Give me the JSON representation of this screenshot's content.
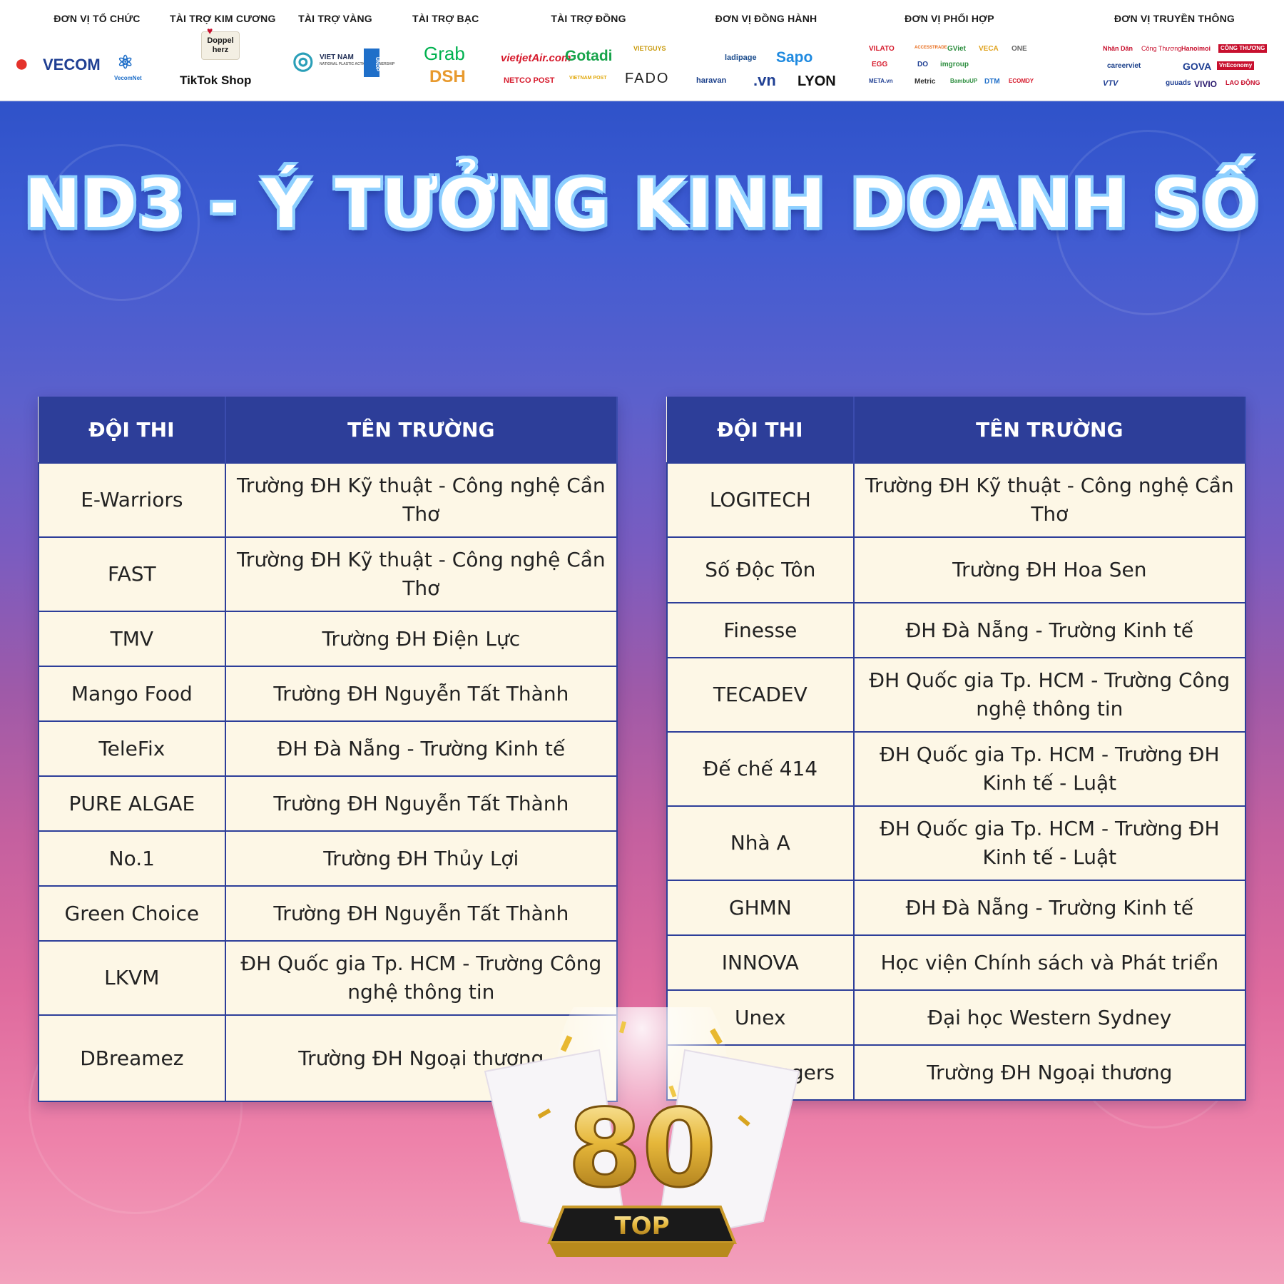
{
  "sponsors": [
    {
      "title": "ĐƠN VỊ TỔ CHỨC",
      "logos": [
        "VECOM",
        "VecomNet"
      ]
    },
    {
      "title": "TÀI TRỢ KIM CƯƠNG",
      "logos": [
        "Doppel herz",
        "TikTok Shop"
      ]
    },
    {
      "title": "TÀI TRỢ VÀNG",
      "logos": [
        "VIET NAM",
        "NATIONAL PLASTIC ACTION PARTNERSHIP",
        "UNDP"
      ]
    },
    {
      "title": "TÀI TRỢ BẠC",
      "logos": [
        "Grab",
        "DSH"
      ]
    },
    {
      "title": "TÀI TRỢ ĐỒNG",
      "logos": [
        "vietjetAir.com",
        "Gotadi",
        "VIETGUYS",
        "NETCO POST",
        "VIETNAM POST",
        "FADO"
      ]
    },
    {
      "title": "ĐƠN VỊ ĐỒNG HÀNH",
      "logos": [
        "ladipage",
        "Sapo",
        "haravan",
        ".vn",
        "LYON"
      ]
    },
    {
      "title": "ĐƠN VỊ PHỐI HỢP",
      "logos": [
        "VILATO",
        "ACCESSTRADE",
        "GViet",
        "VECA",
        "ONE",
        "EGG",
        "DO",
        "imgroup",
        "META.vn",
        "Metric",
        "BambuUP",
        "DTM",
        "ECOMDY"
      ]
    },
    {
      "title": "ĐƠN VỊ TRUYỀN THÔNG",
      "logos": [
        "Nhân Dân",
        "Công Thương",
        "Hanoimoi",
        "CÔNG THƯƠNG",
        "careerviet",
        "GOVA",
        "VnEconomy",
        "VTV",
        "guuads",
        "VIVIO",
        "LAO ĐỘNG"
      ]
    }
  ],
  "page_title": "ND3 - Ý TƯỞNG KINH DOANH SỐ",
  "table_headers": {
    "team": "ĐỘI THI",
    "school": "TÊN TRƯỜNG"
  },
  "left_table": [
    {
      "team": "E-Warriors",
      "school": "Trường ĐH Kỹ thuật - Công nghệ Cần Thơ"
    },
    {
      "team": "FAST",
      "school": "Trường ĐH Kỹ thuật - Công nghệ Cần Thơ"
    },
    {
      "team": "TMV",
      "school": "Trường ĐH Điện Lực"
    },
    {
      "team": "Mango Food",
      "school": "Trường ĐH Nguyễn Tất Thành"
    },
    {
      "team": "TeleFix",
      "school": "ĐH Đà Nẵng - Trường Kinh tế"
    },
    {
      "team": "PURE ALGAE",
      "school": "Trường ĐH Nguyễn Tất Thành"
    },
    {
      "team": "No.1",
      "school": "Trường ĐH Thủy Lợi"
    },
    {
      "team": "Green Choice",
      "school": "Trường ĐH Nguyễn Tất Thành"
    },
    {
      "team": "LKVM",
      "school": "ĐH Quốc gia Tp. HCM - Trường Công nghệ thông tin"
    },
    {
      "team": "DBreamez",
      "school": "Trường ĐH Ngoại thương"
    }
  ],
  "right_table": [
    {
      "team": "LOGITECH",
      "school": "Trường ĐH Kỹ thuật - Công nghệ Cần Thơ"
    },
    {
      "team": "Số Độc Tôn",
      "school": "Trường ĐH Hoa Sen"
    },
    {
      "team": "Finesse",
      "school": "ĐH Đà Nẵng - Trường Kinh tế"
    },
    {
      "team": "TECADEV",
      "school": "ĐH Quốc gia Tp. HCM - Trường Công nghệ thông tin"
    },
    {
      "team": "Đế chế 414",
      "school": "ĐH Quốc gia Tp. HCM - Trường ĐH Kinh tế - Luật"
    },
    {
      "team": "Nhà A",
      "school": "ĐH Quốc gia Tp. HCM - Trường ĐH Kinh tế - Luật"
    },
    {
      "team": "GHMN",
      "school": "ĐH Đà Nẵng - Trường Kinh tế"
    },
    {
      "team": "INNOVA",
      "school": "Học viện Chính sách và Phát triển"
    },
    {
      "team": "Unex",
      "school": "Đại học Western Sydney"
    },
    {
      "team": "Power Rangers",
      "school": "Trường ĐH Ngoại thương"
    }
  ],
  "trophy": {
    "number": "80",
    "label": "TOP"
  },
  "colors": {
    "header_bg": "#2d3e99",
    "cell_bg": "#fdf7e6",
    "border": "#2d3e99",
    "gold": "#d9a520"
  }
}
